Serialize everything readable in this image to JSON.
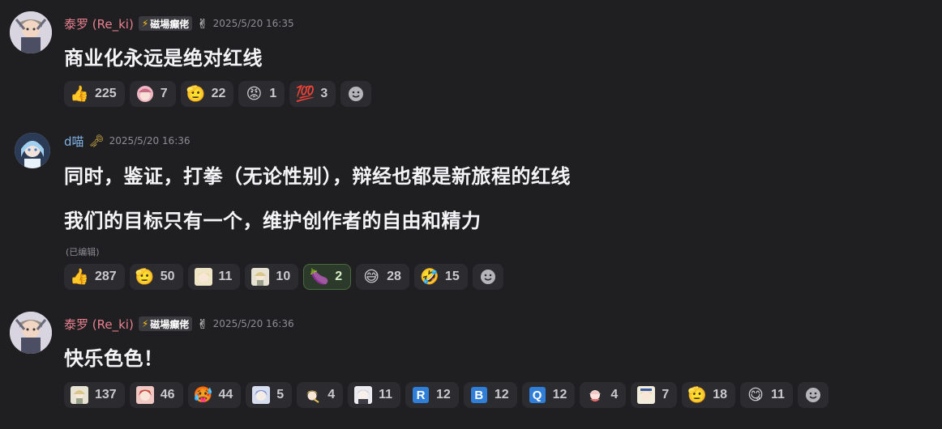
{
  "colors": {
    "background": "#1f1f22",
    "reaction_bg": "#2b2b30",
    "username_pink": "#e8808f",
    "username_blue": "#7fb2e5",
    "timestamp": "#8d8d93",
    "active_reaction_border": "#4a6a40"
  },
  "messages": [
    {
      "username": "泰罗 (Re_ki)",
      "badge": "磁場癲佬",
      "timestamp": "2025/5/20 16:35",
      "lines": [
        "商业化永远是绝对红线"
      ],
      "reactions": [
        {
          "emoji": "👍",
          "icon": "thumbs-up-icon",
          "count": "225"
        },
        {
          "icon": "custom-emoji-pink-character-icon",
          "count": "7"
        },
        {
          "emoji": "🫡",
          "icon": "saluting-face-icon",
          "count": "22"
        },
        {
          "emoji": "😡",
          "icon": "angry-face-icon",
          "count": "1"
        },
        {
          "emoji": "💯",
          "icon": "hundred-points-icon",
          "count": "3"
        }
      ]
    },
    {
      "username": "d喵",
      "timestamp": "2025/5/20 16:36",
      "lines": [
        "同时，鉴证，打拳（无论性别），辩经也都是新旅程的红线",
        "我们的目标只有一个，维护创作者的自由和精力"
      ],
      "edited": "(已编辑)",
      "reactions": [
        {
          "emoji": "👍",
          "icon": "thumbs-up-icon",
          "count": "287"
        },
        {
          "emoji": "🫡",
          "icon": "saluting-face-icon",
          "count": "50"
        },
        {
          "icon": "custom-emoji-blonde-character-icon",
          "count": "11"
        },
        {
          "icon": "custom-emoji-chibi-character-icon",
          "count": "10"
        },
        {
          "emoji": "🍆",
          "icon": "eggplant-icon",
          "count": "2"
        },
        {
          "emoji": "😅",
          "icon": "grinning-sweat-icon",
          "count": "28"
        },
        {
          "emoji": "🤣",
          "icon": "rolling-laughing-icon",
          "count": "15"
        }
      ]
    },
    {
      "username": "泰罗 (Re_ki)",
      "badge": "磁場癲佬",
      "timestamp": "2025/5/20 16:36",
      "lines": [
        "快乐色色！"
      ],
      "reactions": [
        {
          "icon": "custom-emoji-chibi-character-icon",
          "count": "137"
        },
        {
          "icon": "custom-emoji-red-character-icon",
          "count": "46"
        },
        {
          "emoji": "🥵",
          "icon": "hot-face-icon",
          "count": "44"
        },
        {
          "icon": "custom-emoji-blue-hair-character-icon",
          "count": "5"
        },
        {
          "icon": "custom-emoji-blonde-character-icon",
          "count": "4"
        },
        {
          "icon": "custom-emoji-white-character-icon",
          "count": "11"
        },
        {
          "letter": "R",
          "icon": "letter-r-icon",
          "count": "12"
        },
        {
          "letter": "B",
          "icon": "letter-b-icon",
          "count": "12"
        },
        {
          "letter": "Q",
          "icon": "letter-q-icon",
          "count": "12"
        },
        {
          "icon": "custom-emoji-girl-character-icon",
          "count": "4"
        },
        {
          "icon": "custom-emoji-blonde-character-icon",
          "count": "7"
        },
        {
          "emoji": "🫡",
          "icon": "saluting-face-icon",
          "count": "18"
        },
        {
          "emoji": "😋",
          "icon": "yum-face-icon",
          "count": "11"
        }
      ]
    }
  ]
}
